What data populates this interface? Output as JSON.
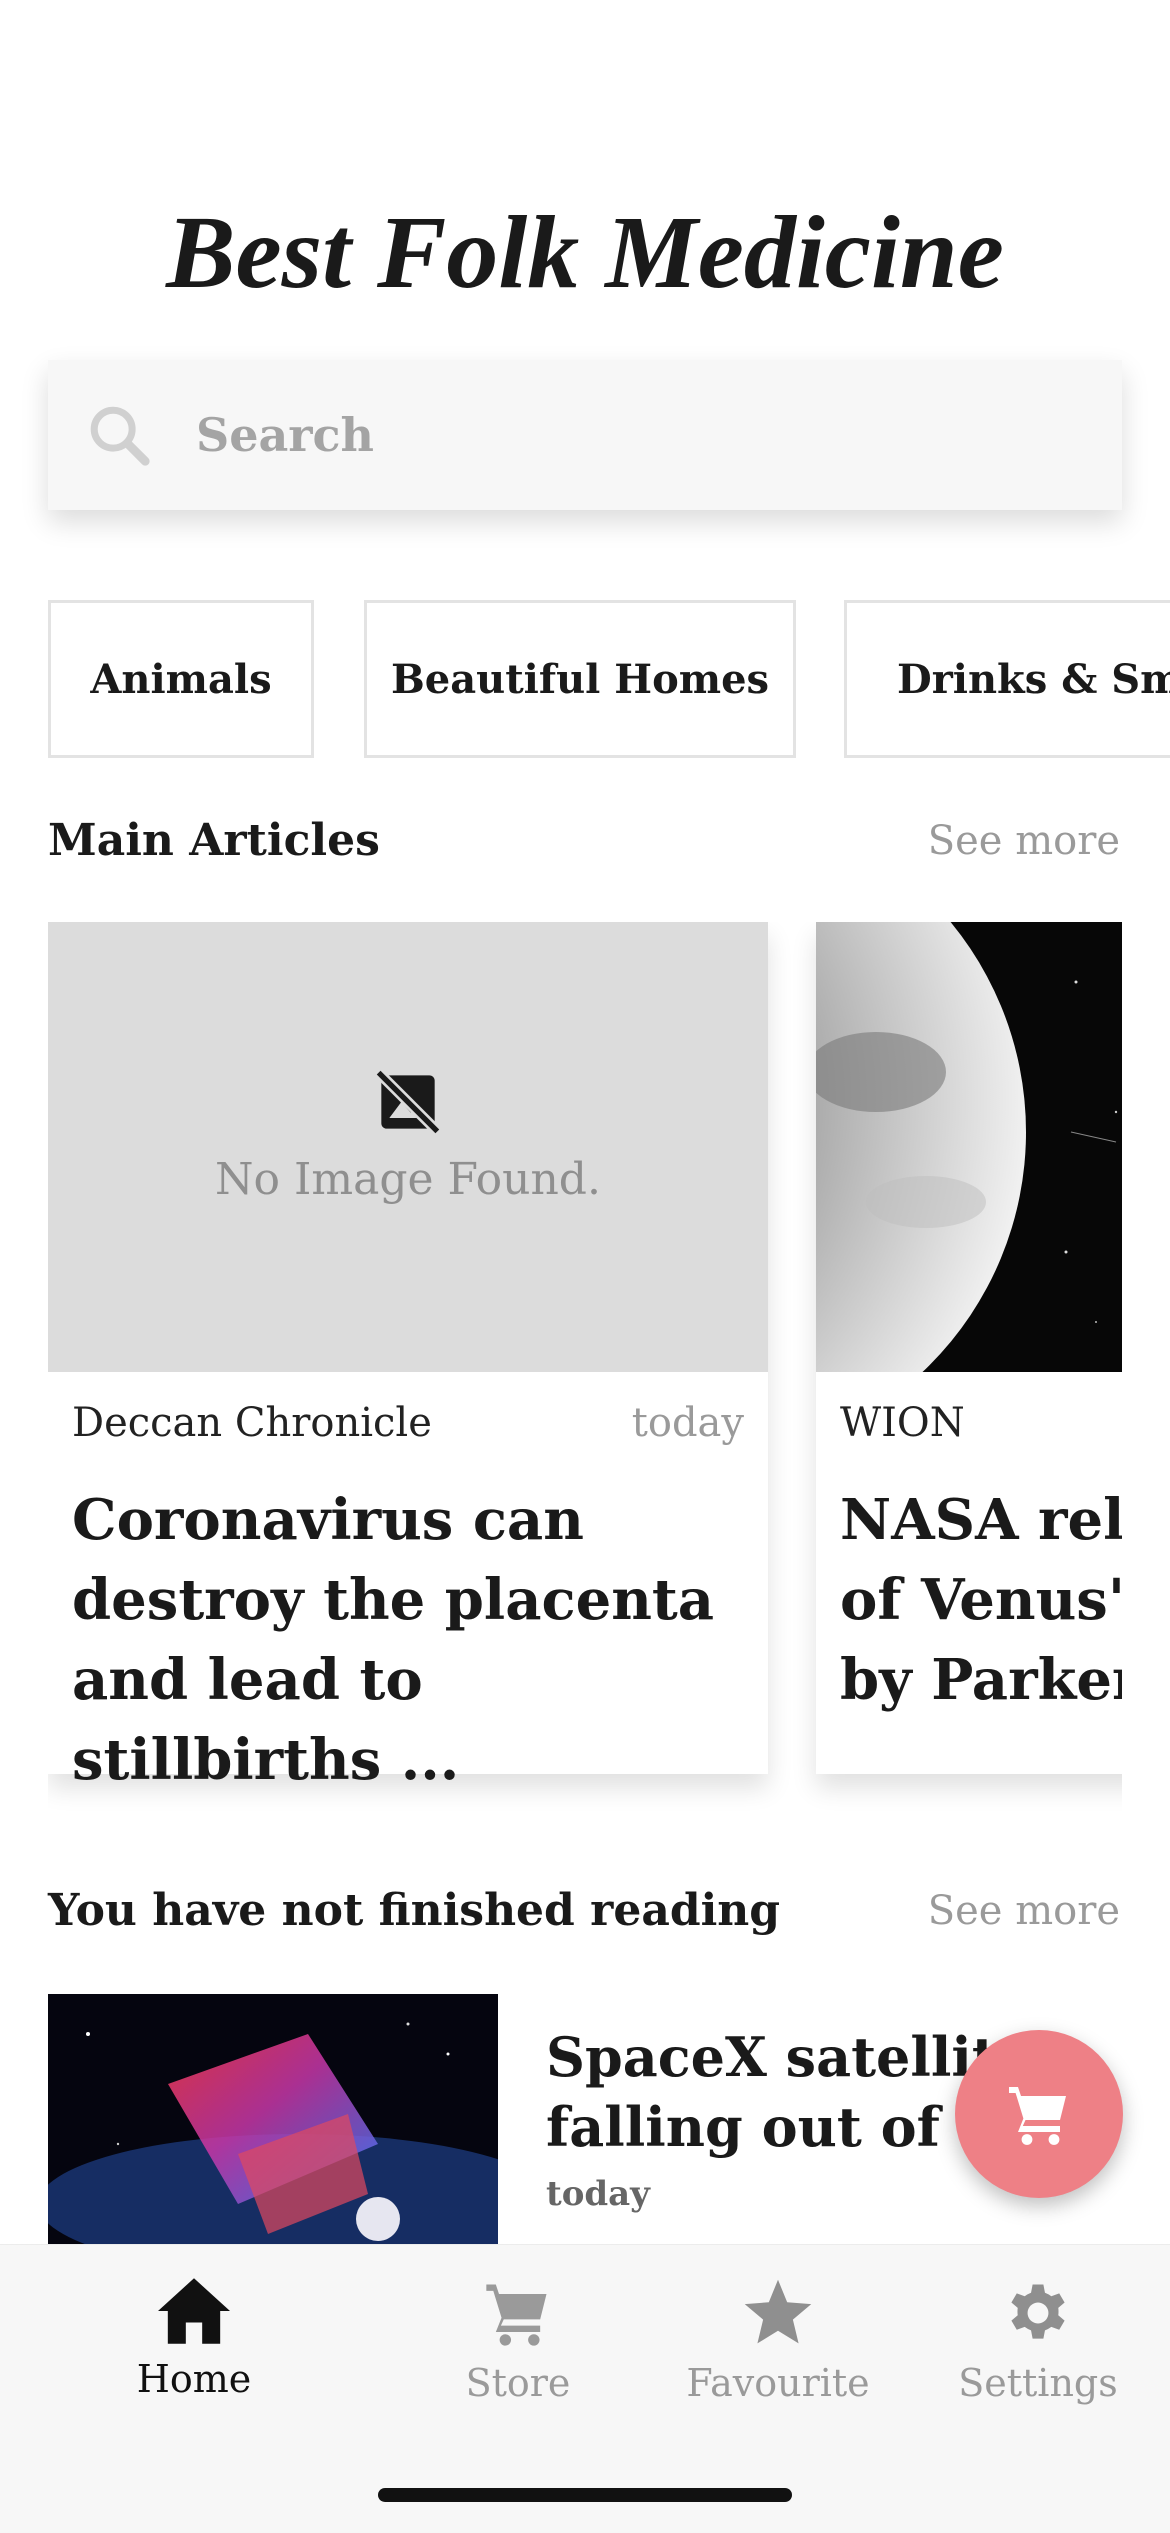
{
  "app": {
    "title": "Best Folk Medicine"
  },
  "search": {
    "placeholder": "Search",
    "value": ""
  },
  "categories": [
    "Animals",
    "Beautiful Homes",
    "Drinks & Smo"
  ],
  "main_articles": {
    "title": "Main Articles",
    "see_more": "See more",
    "items": [
      {
        "image_placeholder": "No Image Found.",
        "source": "Deccan Chronicle",
        "date": "today",
        "headline_lines": [
          "Coronavirus can",
          "destroy the placenta",
          "and lead to stillbirths ..."
        ]
      },
      {
        "source": "WION",
        "headline_lines": [
          "NASA relea",
          "of Venus's",
          "by Parker"
        ]
      }
    ]
  },
  "unfinished": {
    "title": "You have not finished reading",
    "see_more": "See more",
    "item": {
      "headline_lines": [
        "SpaceX satellites",
        "falling out of orb"
      ],
      "date": "today"
    }
  },
  "bottom_nav": [
    {
      "label": "Home",
      "icon": "home-icon",
      "active": true
    },
    {
      "label": "Store",
      "icon": "cart-icon",
      "active": false
    },
    {
      "label": "Favourite",
      "icon": "star-icon",
      "active": false
    },
    {
      "label": "Settings",
      "icon": "gear-icon",
      "active": false
    }
  ],
  "colors": {
    "fab": "#ee8086",
    "active_nav": "#111111",
    "inactive_nav": "#9a9a9a"
  }
}
